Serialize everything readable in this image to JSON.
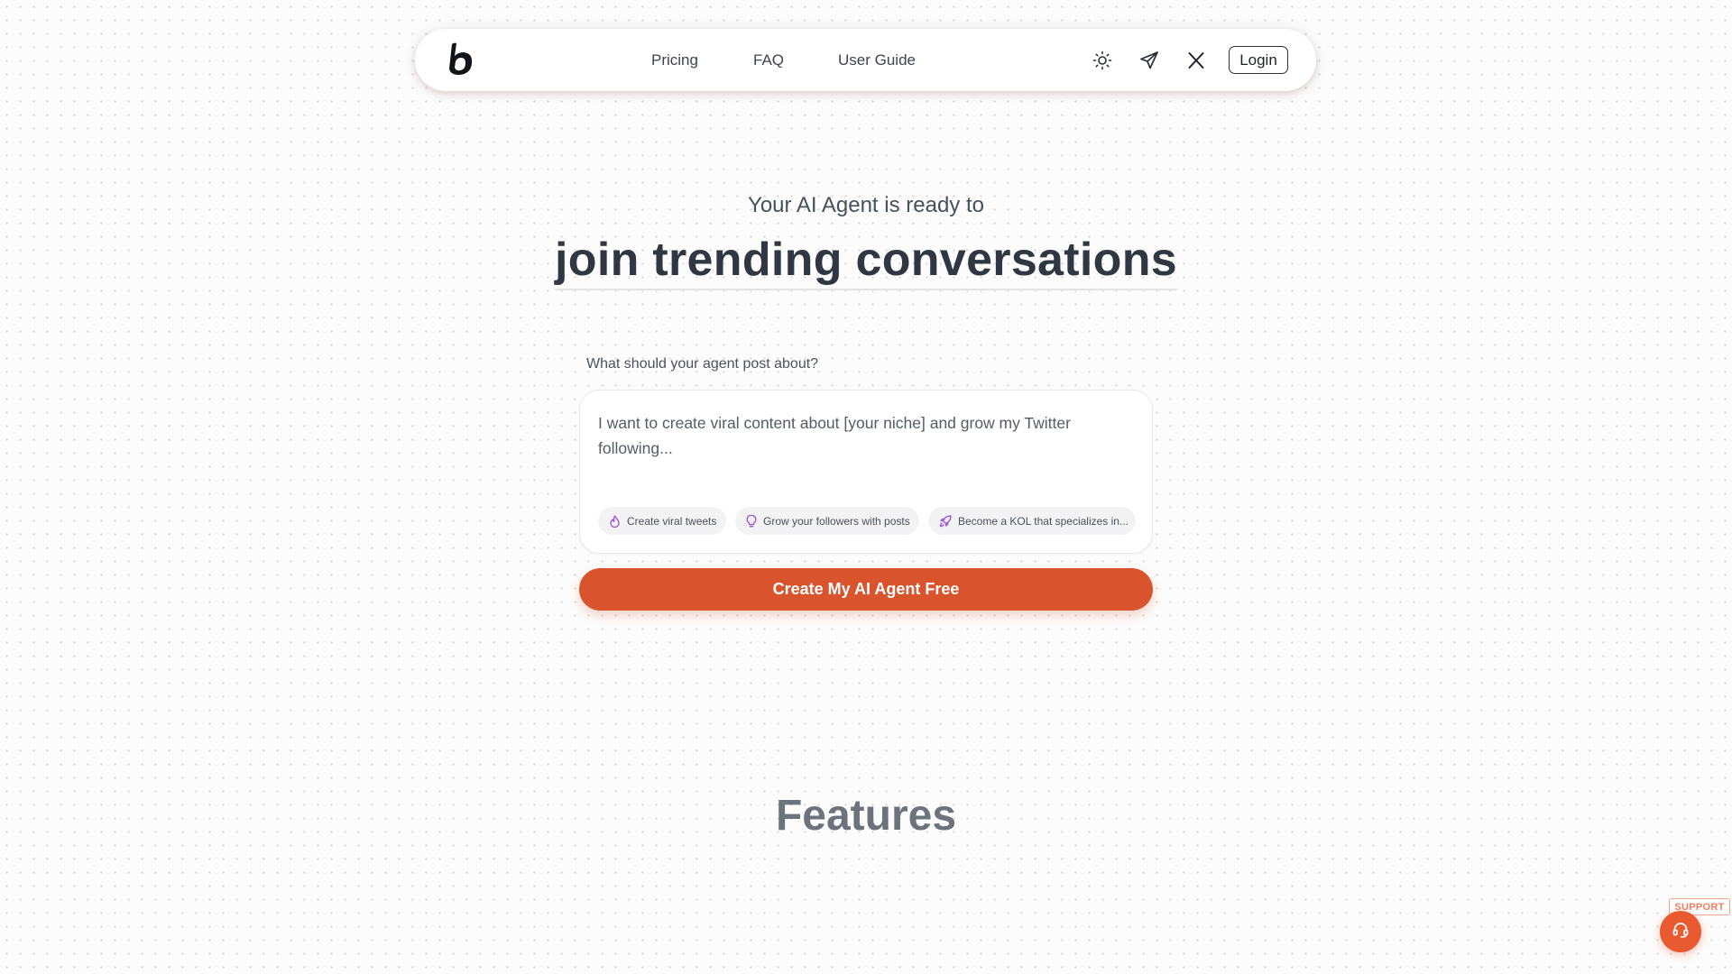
{
  "nav": {
    "logo_icon": "brand-b-logo",
    "links": [
      {
        "label": "Pricing"
      },
      {
        "label": "FAQ"
      },
      {
        "label": "User Guide"
      }
    ],
    "icons": [
      "theme-toggle-sun-icon",
      "telegram-send-icon",
      "x-twitter-icon"
    ],
    "login_label": "Login"
  },
  "hero": {
    "subtitle": "Your AI Agent is ready to",
    "title": "join trending conversations"
  },
  "prompt": {
    "label": "What should your agent post about?",
    "placeholder": "I want to create viral content about [your niche] and grow my Twitter following...",
    "suggestions": [
      {
        "label": "Create viral tweets",
        "icon": "flame-icon"
      },
      {
        "label": "Grow your followers with posts",
        "icon": "lightbulb-icon"
      },
      {
        "label": "Become a KOL that specializes in...",
        "icon": "rocket-icon"
      }
    ]
  },
  "cta": {
    "label": "Create My AI Agent Free"
  },
  "features": {
    "title": "Features"
  },
  "support": {
    "label": "SUPPORT",
    "icon": "headset-icon"
  },
  "colors": {
    "accent": "#d9542c",
    "support": "#ea5a30",
    "chip_icon": "#9b4fd1",
    "text_dark": "#2f3742"
  }
}
